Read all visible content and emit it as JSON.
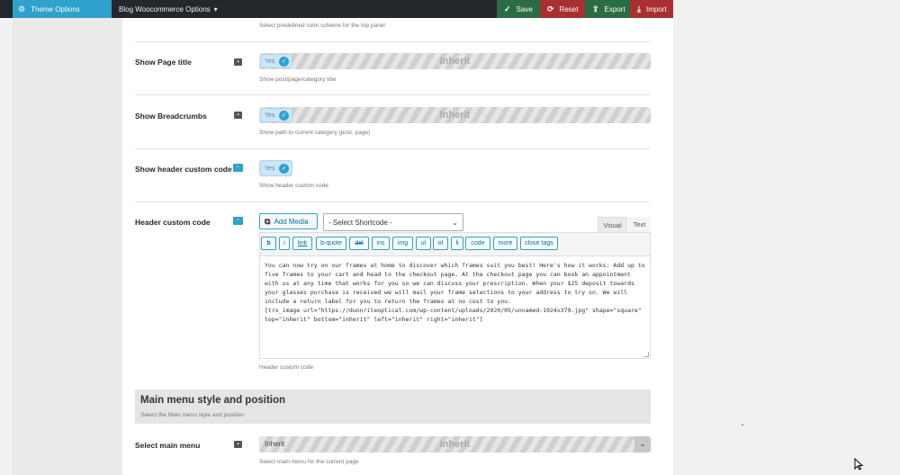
{
  "topbar": {
    "theme_tab": "Theme Options",
    "site_menu": "Blog Woocommerce Options",
    "save": "Save",
    "reset": "Reset",
    "export": "Export",
    "import": "Import"
  },
  "rows": {
    "top_desc": "Select predefined color scheme for the top panel",
    "page_title": {
      "label": "Show Page title",
      "toggle": "Yes",
      "inherit": "Inherit",
      "desc": "Show post/page/category title"
    },
    "breadcrumbs": {
      "label": "Show Breadcrumbs",
      "toggle": "Yes",
      "inherit": "Inherit",
      "desc": "Show path to current category (post, page)"
    },
    "header_code": {
      "label": "Show header custom code",
      "toggle": "Yes",
      "desc": "Show header custom code"
    },
    "custom_code": {
      "label": "Header custom code",
      "desc": "Header custom code"
    }
  },
  "editor": {
    "add_media": "Add Media",
    "shortcode": "- Select Shortcode -",
    "tab_visual": "Visual",
    "tab_text": "Text",
    "quicktags": [
      "b",
      "i",
      "link",
      "b-quote",
      "del",
      "ins",
      "img",
      "ul",
      "ol",
      "li",
      "code",
      "more",
      "close tags"
    ],
    "content": "You can now try on our frames at home to discover which frames suit you best! Here's how it works: Add up to five frames to your cart and head to the checkout page. At the checkout page you can book an appointment with us at any time that works for you so we can discuss your prescription. When your $25 deposit towards your glasses purchase is received we will mail your frame selections to your address to try on. We will include a return label for you to return the frames at no cost to you.\n[trx_image url=\"https://dunnriteoptical.com/wp-content/uploads/2020/05/unnamed-1024x379.jpg\" shape=\"square\" top=\"inherit\" bottom=\"inherit\" left=\"inherit\" right=\"inherit\"]"
  },
  "section": {
    "title": "Main menu style and position",
    "subtitle": "Select the Main menu style and position"
  },
  "main_menu": {
    "label": "Select main menu",
    "value": "Inherit",
    "inherit": "Inherit",
    "desc": "Select main menu for the current page"
  },
  "icons": {
    "gear": "gear-icon",
    "check": "check-icon",
    "reset": "refresh-icon",
    "export": "upload-icon",
    "import": "download-icon",
    "lock": "lock-icon",
    "device": "device-icon"
  }
}
